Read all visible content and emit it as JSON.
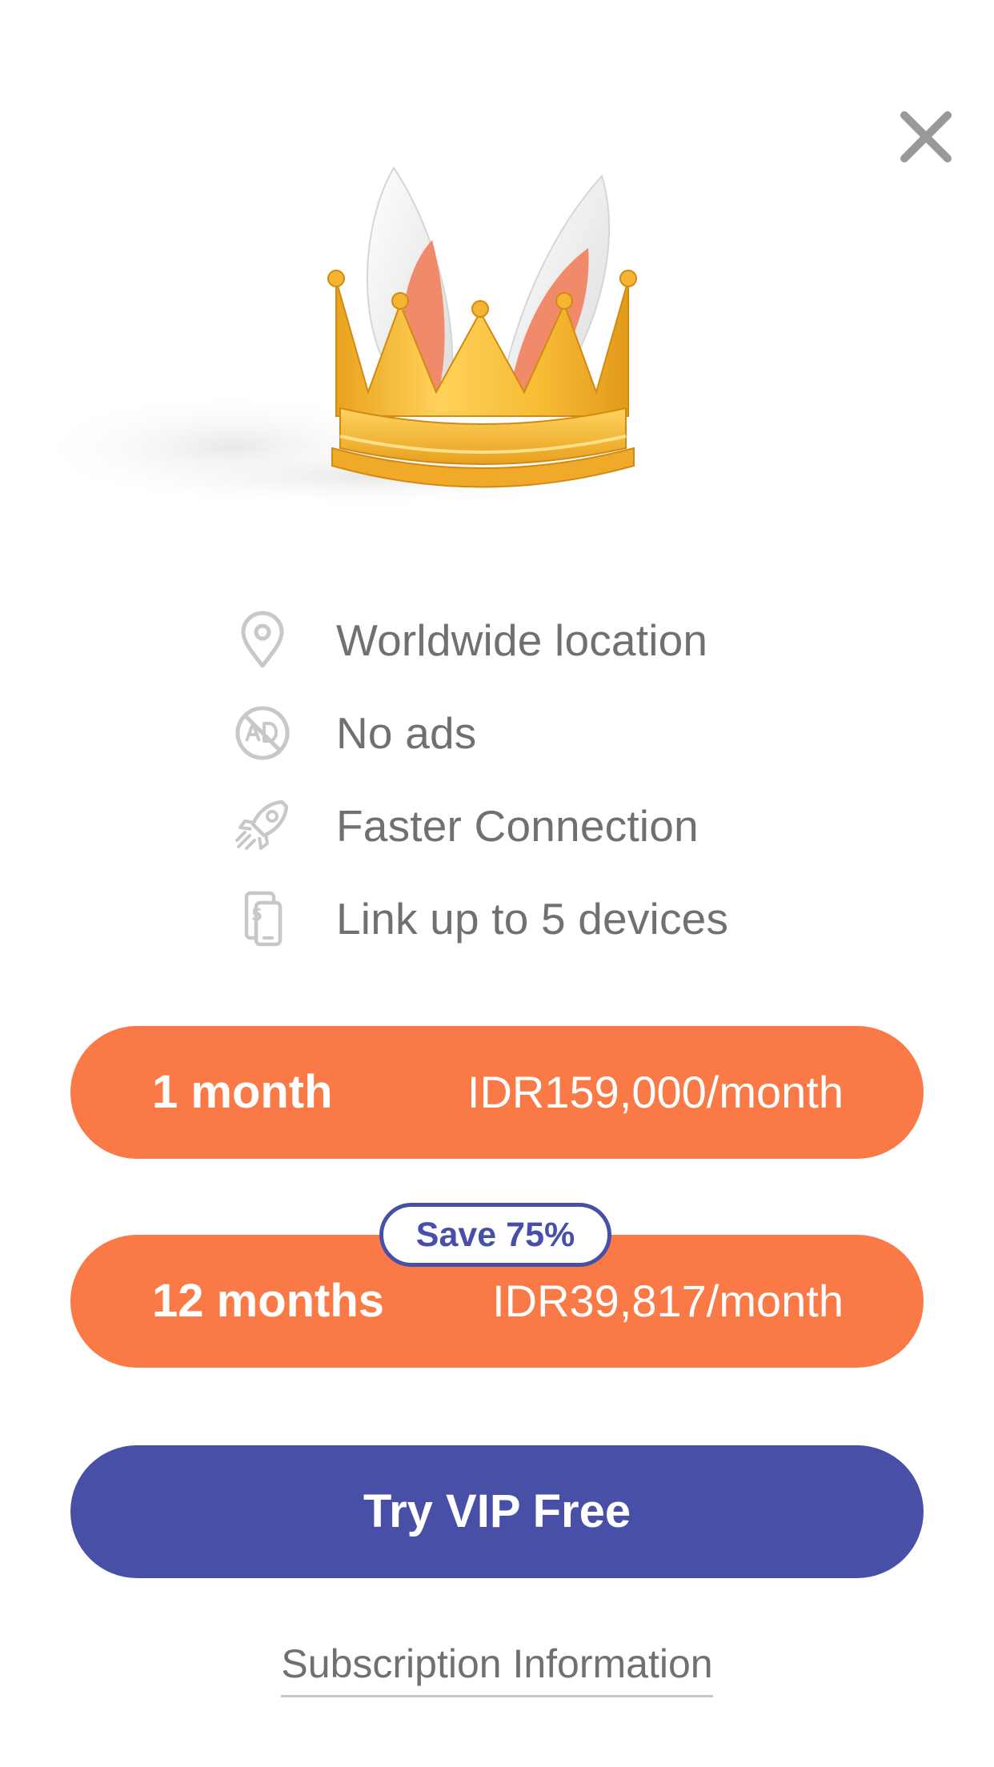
{
  "screen": "vip-subscription",
  "close": {
    "icon": "close-icon"
  },
  "hero": {
    "image": "crown-with-bunny-ears"
  },
  "features": [
    {
      "icon": "location-pin-icon",
      "label": "Worldwide location"
    },
    {
      "icon": "no-ads-icon",
      "label": "No ads"
    },
    {
      "icon": "rocket-icon",
      "label": "Faster Connection"
    },
    {
      "icon": "devices-icon",
      "label": "Link up to 5 devices"
    }
  ],
  "plans": [
    {
      "term": "1 month",
      "price": "IDR159,000/month"
    },
    {
      "term": "12 months",
      "price": "IDR39,817/month",
      "badge": "Save 75%"
    }
  ],
  "cta": {
    "label": "Try VIP Free"
  },
  "footer": {
    "link": "Subscription Information"
  },
  "colors": {
    "plan_background": "#f97a46",
    "cta_background": "#4750a6",
    "feature_text": "#707070",
    "icon_gray": "#c8c8c8",
    "crown_gold": "#f5b531",
    "ear_pink": "#f08a6a"
  }
}
